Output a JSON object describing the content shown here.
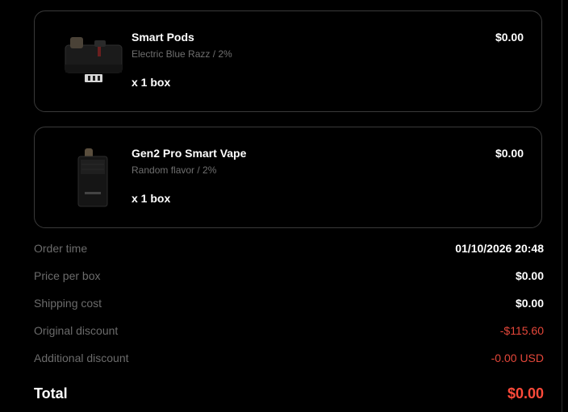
{
  "items": [
    {
      "name": "Smart Pods",
      "variant": "Electric Blue Razz / 2%",
      "quantity": "x 1 box",
      "price": "$0.00",
      "image_icon": "pod-cartridge-icon"
    },
    {
      "name": "Gen2 Pro Smart Vape",
      "variant": "Random flavor / 2%",
      "quantity": "x 1 box",
      "price": "$0.00",
      "image_icon": "vape-device-icon"
    }
  ],
  "summary": {
    "order_time_label": "Order time",
    "order_time_value": "01/10/2026 20:48",
    "price_per_box_label": "Price per box",
    "price_per_box_value": "$0.00",
    "shipping_cost_label": "Shipping cost",
    "shipping_cost_value": "$0.00",
    "original_discount_label": "Original discount",
    "original_discount_value": "-$115.60",
    "additional_discount_label": "Additional discount",
    "additional_discount_value": "-0.00 USD",
    "total_label": "Total",
    "total_value": "$0.00"
  },
  "colors": {
    "background": "#000000",
    "card_border": "#3a3a3a",
    "muted_text": "#6b6b6b",
    "discount_red": "#e5473a",
    "total_red": "#ff4a3a"
  }
}
